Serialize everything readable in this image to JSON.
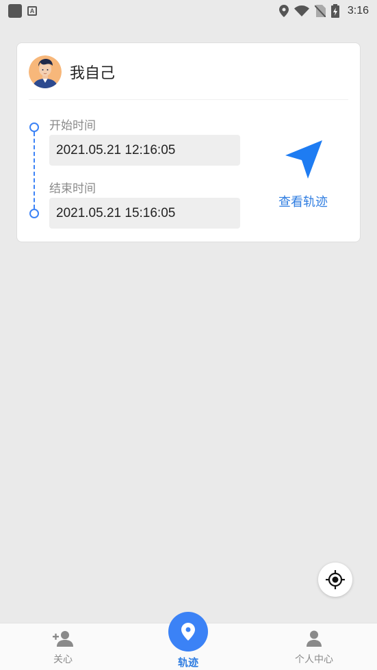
{
  "status_bar": {
    "time": "3:16",
    "icons": [
      "app-square-icon",
      "a-icon",
      "location-icon",
      "wifi-icon",
      "no-sim-icon",
      "battery-charging-icon"
    ]
  },
  "card": {
    "user_name": "我自己",
    "start_label": "开始时间",
    "start_time": "2021.05.21 12:16:05",
    "end_label": "结束时间",
    "end_time": "2021.05.21 15:16:05",
    "track_button_label": "查看轨迹"
  },
  "bottom_nav": {
    "items": [
      {
        "label": "关心",
        "icon": "add-user-icon",
        "active": false
      },
      {
        "label": "轨迹",
        "icon": "map-pin-icon",
        "active": true
      },
      {
        "label": "个人中心",
        "icon": "person-icon",
        "active": false
      }
    ]
  },
  "colors": {
    "accent": "#3b82f6",
    "accent_text": "#2f7de1",
    "background": "#eaeaea"
  }
}
